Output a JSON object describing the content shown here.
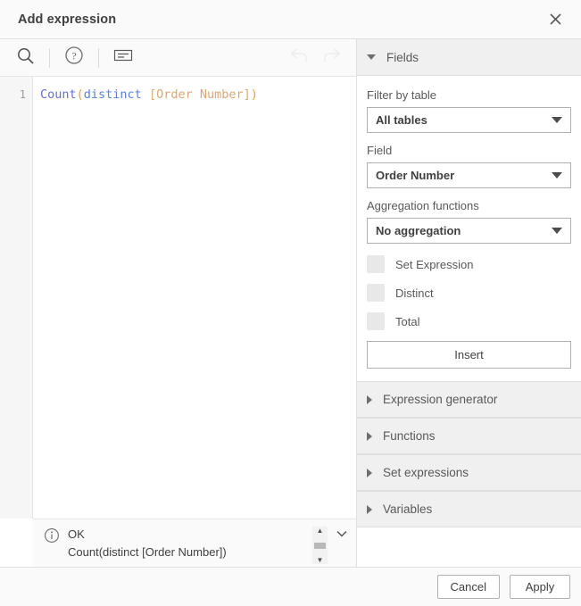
{
  "dialog": {
    "title": "Add expression",
    "close_icon": "close-icon"
  },
  "toolbar": {
    "items": [
      {
        "icon": "search-icon",
        "label": "Search",
        "disabled": false
      },
      {
        "icon": "help-circle-icon",
        "label": "Help",
        "disabled": false
      },
      {
        "icon": "word-wrap-icon",
        "label": "Toggle wrap",
        "disabled": false
      },
      {
        "icon": "undo-icon",
        "label": "Undo",
        "disabled": true
      },
      {
        "icon": "redo-icon",
        "label": "Redo",
        "disabled": true
      }
    ]
  },
  "editor": {
    "line_number": "1",
    "expression": "Count(distinct [Order Number])",
    "tokens": [
      {
        "text": "Count",
        "type": "function"
      },
      {
        "text": "(",
        "type": "paren"
      },
      {
        "text": "distinct",
        "type": "keyword"
      },
      {
        "text": " ",
        "type": "plain"
      },
      {
        "text": "[Order Number]",
        "type": "field"
      },
      {
        "text": ")",
        "type": "paren"
      }
    ]
  },
  "status": {
    "icon": "info-icon",
    "state": "OK",
    "preview": "Count(distinct [Order Number])",
    "scroll_up_icon": "caret-up-icon",
    "scroll_down_icon": "caret-down-icon",
    "expand_icon": "chevron-down-icon"
  },
  "panel": {
    "fields_section": {
      "title": "Fields",
      "expanded": true,
      "filter_label": "Filter by table",
      "filter_value": "All tables",
      "field_label": "Field",
      "field_value": "Order Number",
      "aggregation_label": "Aggregation functions",
      "aggregation_value": "No aggregation",
      "checkboxes": [
        {
          "label": "Set Expression",
          "checked": false
        },
        {
          "label": "Distinct",
          "checked": false
        },
        {
          "label": "Total",
          "checked": false
        }
      ],
      "insert_label": "Insert"
    },
    "sections": [
      {
        "title": "Expression generator",
        "expanded": false
      },
      {
        "title": "Functions",
        "expanded": false
      },
      {
        "title": "Set expressions",
        "expanded": false
      },
      {
        "title": "Variables",
        "expanded": false
      }
    ]
  },
  "footer": {
    "cancel_label": "Cancel",
    "apply_label": "Apply"
  },
  "colors": {
    "accent_function": "#6a6ad4",
    "accent_keyword": "#5b7fd4",
    "accent_field": "#d8a878",
    "accent_paren": "#e8a33d",
    "panel_header_bg": "#f0f0f0",
    "chrome_bg": "#fafafa"
  }
}
